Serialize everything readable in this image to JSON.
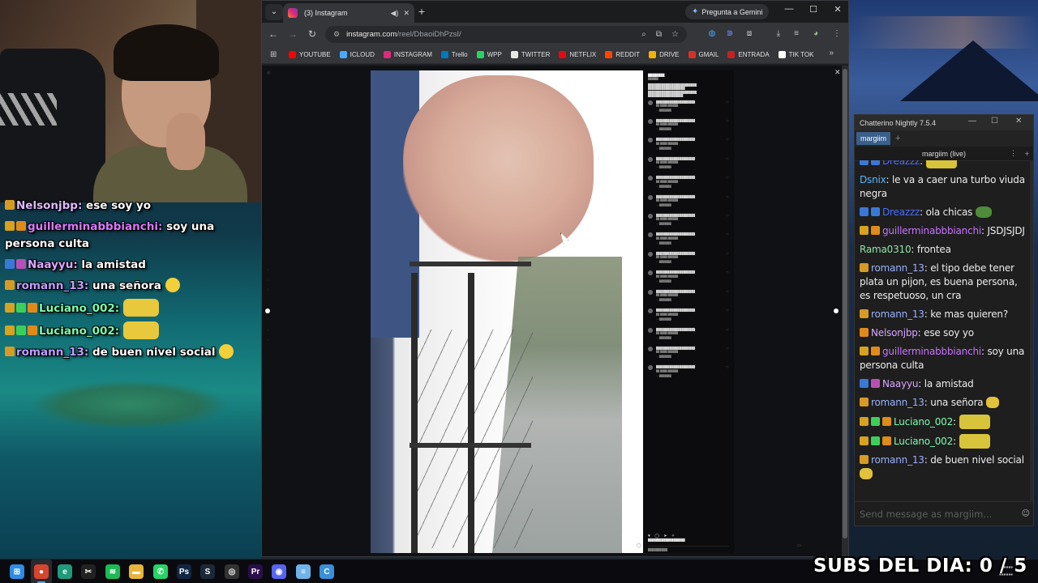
{
  "overlay_chat": [
    {
      "user": "Nelsonjbp",
      "color": "#e0b8ff",
      "text": " ese soy yo",
      "badges": [
        "#d69b24"
      ]
    },
    {
      "user": "guillerminabbbianchi",
      "color": "#d97bff",
      "text": " soy una persona culta",
      "badges": [
        "#d6a21f",
        "#e08a1a"
      ]
    },
    {
      "user": "Naayyu",
      "color": "#d9a6ff",
      "text": " la amistad",
      "badges": [
        "#3a78d8",
        "#b84fb4"
      ]
    },
    {
      "user": "romann_13",
      "color": "#c09eff",
      "text": " una señora",
      "badges": [
        "#d69b24"
      ],
      "emote": "small"
    },
    {
      "user": "Luciano_002",
      "color": "#7dffb0",
      "text": "",
      "badges": [
        "#d6a21f",
        "#3cd05a",
        "#e08a1a"
      ],
      "emote": "big"
    },
    {
      "user": "Luciano_002",
      "color": "#7dffb0",
      "text": "",
      "badges": [
        "#d6a21f",
        "#3cd05a",
        "#e08a1a"
      ],
      "emote": "big"
    },
    {
      "user": "romann_13",
      "color": "#c09eff",
      "text": " de buen nivel social",
      "badges": [
        "#d69b24"
      ],
      "emote": "small"
    }
  ],
  "browser": {
    "tab_title": "(3) Instagram",
    "gemini_label": "Pregunta a Gemini",
    "url_host": "instagram.com",
    "url_path": "/reel/DbaoiDhPzsI/",
    "bookmarks": [
      {
        "label": "YOUTUBE",
        "color": "#ff0000"
      },
      {
        "label": "ICLOUD",
        "color": "#4aa8ff"
      },
      {
        "label": "INSTAGRAM",
        "color": "#dd2a7b"
      },
      {
        "label": "Trello",
        "color": "#0079bf"
      },
      {
        "label": "WPP",
        "color": "#25d366"
      },
      {
        "label": "TWITTER",
        "color": "#e7e7e7"
      },
      {
        "label": "NETFLIX",
        "color": "#e50914"
      },
      {
        "label": "REDDIT",
        "color": "#ff4500"
      },
      {
        "label": "DRIVE",
        "color": "#f4b400"
      },
      {
        "label": "GMAIL",
        "color": "#d93025"
      },
      {
        "label": "ENTRADA",
        "color": "#c5221f"
      },
      {
        "label": "TIK TOK",
        "color": "#ffffff"
      }
    ]
  },
  "chatterino": {
    "window_title": "Chatterino Nightly 7.5.4",
    "tab": "margiim",
    "channel_header": "margiim (live)",
    "input_placeholder": "Send message as margiim...",
    "messages": [
      {
        "user": "Dreazzz",
        "color": "#4a6cff",
        "text": "",
        "badges": [
          "#3a78d8",
          "#3a78d8"
        ],
        "emote": "big",
        "partial": true
      },
      {
        "user": "Dsnix",
        "color": "#57b7ff",
        "text": " le va a caer una turbo viuda negra",
        "badges": []
      },
      {
        "user": "Dreazzz",
        "color": "#4a6cff",
        "text": " ola chicas",
        "badges": [
          "#3a78d8",
          "#3a78d8"
        ],
        "emote": "frog"
      },
      {
        "user": "guillerminabbbianchi",
        "color": "#c873ff",
        "text": " JSDJSJDJ",
        "badges": [
          "#d6a21f",
          "#e08a1a"
        ]
      },
      {
        "user": "Rama0310",
        "color": "#8fe3a6",
        "text": " frontea",
        "badges": []
      },
      {
        "user": "romann_13",
        "color": "#9ab0ff",
        "text": " el tipo debe tener plata un pijon, es buena persona, es respetuoso, un cra",
        "badges": [
          "#d69b24"
        ]
      },
      {
        "user": "romann_13",
        "color": "#9ab0ff",
        "text": " ke mas quieren?",
        "badges": [
          "#d69b24"
        ]
      },
      {
        "user": "Nelsonjbp",
        "color": "#d6a6ff",
        "text": " ese soy yo",
        "badges": [
          "#e08a1a"
        ]
      },
      {
        "user": "guillerminabbbianchi",
        "color": "#c873ff",
        "text": " soy una persona culta",
        "badges": [
          "#d6a21f",
          "#e08a1a"
        ]
      },
      {
        "user": "Naayyu",
        "color": "#d9a6ff",
        "text": " la amistad",
        "badges": [
          "#3a78d8",
          "#b84fb4"
        ]
      },
      {
        "user": "romann_13",
        "color": "#9ab0ff",
        "text": " una señora",
        "badges": [
          "#d69b24"
        ],
        "emote": "small"
      },
      {
        "user": "Luciano_002",
        "color": "#7dffb0",
        "text": "",
        "badges": [
          "#d6a21f",
          "#3cd05a",
          "#e08a1a"
        ],
        "emote": "big"
      },
      {
        "user": "Luciano_002",
        "color": "#7dffb0",
        "text": "",
        "badges": [
          "#d6a21f",
          "#3cd05a",
          "#e08a1a"
        ],
        "emote": "big"
      },
      {
        "user": "romann_13",
        "color": "#9ab0ff",
        "text": " de buen nivel social",
        "badges": [
          "#d69b24"
        ],
        "emote": "small"
      }
    ]
  },
  "subs_overlay": "SUBS DEL DIA: 0 / 5",
  "taskbar_icons": [
    {
      "name": "windows-start-icon",
      "color": "#2f8be6",
      "glyph": "⊞"
    },
    {
      "name": "chrome-icon",
      "color": "#d6452e",
      "glyph": "●"
    },
    {
      "name": "edge-icon",
      "color": "#1f9a7a",
      "glyph": "e"
    },
    {
      "name": "capcut-icon",
      "color": "#222",
      "glyph": "✂"
    },
    {
      "name": "spotify-icon",
      "color": "#1db954",
      "glyph": "≋"
    },
    {
      "name": "folder-icon",
      "color": "#e7b53b",
      "glyph": "▬"
    },
    {
      "name": "whatsapp-icon",
      "color": "#25d366",
      "glyph": "✆"
    },
    {
      "name": "photoshop-icon",
      "color": "#0f2742",
      "glyph": "Ps"
    },
    {
      "name": "steam-icon",
      "color": "#1b2838",
      "glyph": "S"
    },
    {
      "name": "obs-icon",
      "color": "#333",
      "glyph": "◎"
    },
    {
      "name": "premiere-icon",
      "color": "#2a0f4a",
      "glyph": "Pr"
    },
    {
      "name": "discord-icon",
      "color": "#5865f2",
      "glyph": "◉"
    },
    {
      "name": "notepad-icon",
      "color": "#6fb3e8",
      "glyph": "≡"
    },
    {
      "name": "chatterino-icon",
      "color": "#3a8fd8",
      "glyph": "C"
    }
  ]
}
